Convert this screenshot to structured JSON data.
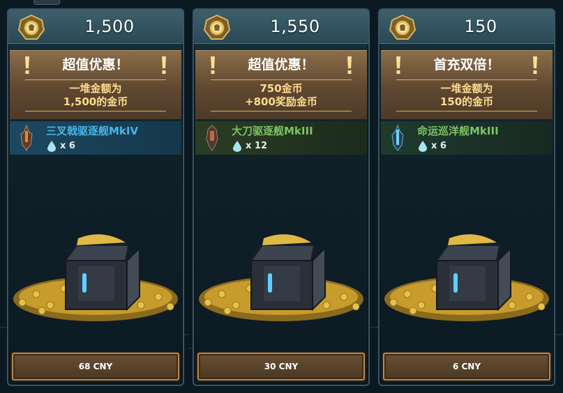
{
  "cards": [
    {
      "amount": "1,500",
      "offer_title": "超值优惠！",
      "offer_line1": "一堆金额为",
      "offer_line2": "1,500的金币",
      "ship_name": "三叉戟驱逐舰MkIV",
      "quantity": "x 6",
      "price": "68 CNY",
      "ship_color": "#46b7e8"
    },
    {
      "amount": "1,550",
      "offer_title": "超值优惠！",
      "offer_line1": "750金币",
      "offer_line2": "+800奖励金币",
      "ship_name": "大刀驱逐舰MkIII",
      "quantity": "x 12",
      "price": "30 CNY",
      "ship_color": "#7cc465"
    },
    {
      "amount": "150",
      "offer_title": "首充双倍！",
      "offer_line1": "一堆金额为",
      "offer_line2": "150的金币",
      "ship_name": "命运巡洋舰MkIII",
      "quantity": "x 6",
      "price": "6 CNY",
      "ship_color": "#7cc465"
    }
  ],
  "icons": {
    "coin_badge": "gold-coin-badge-icon",
    "exclamation": "exclamation-icon",
    "drop": "water-drop-icon",
    "chest": "gold-chest-icon"
  },
  "colors": {
    "offer_text": "#ffdb8f",
    "button_border": "#b98a4e",
    "card_border": "#3a5666"
  }
}
